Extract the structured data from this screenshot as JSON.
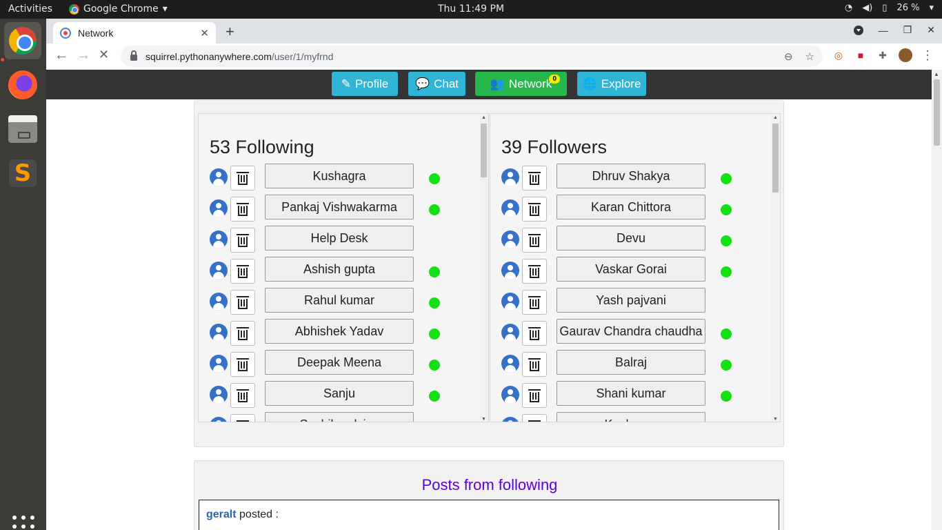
{
  "system": {
    "activities": "Activities",
    "app_name": "Google Chrome",
    "clock": "Thu 11:49 PM",
    "battery": "26 %"
  },
  "browser": {
    "tab_title": "Network",
    "url_host": "squirrel.pythonanywhere.com",
    "url_path": "/user/1/myfrnd"
  },
  "navbar": {
    "profile": "Profile",
    "chat": "Chat",
    "network": "Network",
    "network_badge": "0",
    "explore": "Explore"
  },
  "following": {
    "title": "53 Following",
    "items": [
      {
        "name": "Kushagra",
        "online": true
      },
      {
        "name": "Pankaj Vishwakarma",
        "online": true
      },
      {
        "name": "Help Desk",
        "online": false
      },
      {
        "name": "Ashish gupta",
        "online": true
      },
      {
        "name": "Rahul kumar",
        "online": true
      },
      {
        "name": "Abhishek Yadav",
        "online": true
      },
      {
        "name": "Deepak Meena",
        "online": true
      },
      {
        "name": "Sanju",
        "online": true
      },
      {
        "name": "Sushil malviya",
        "online": false
      }
    ]
  },
  "followers": {
    "title": "39 Followers",
    "items": [
      {
        "name": "Dhruv Shakya",
        "online": true
      },
      {
        "name": "Karan Chittora",
        "online": true
      },
      {
        "name": "Devu",
        "online": true
      },
      {
        "name": "Vaskar Gorai",
        "online": true
      },
      {
        "name": "Yash pajvani",
        "online": false
      },
      {
        "name": "Gaurav Chandra chaudha",
        "online": true
      },
      {
        "name": "Balraj",
        "online": true
      },
      {
        "name": "Shani kumar",
        "online": true
      },
      {
        "name": "Kushagra",
        "online": true
      }
    ]
  },
  "posts": {
    "title": "Posts from following",
    "first_author": "geralt",
    "first_action": " posted :"
  },
  "colors": {
    "online": "#12e012",
    "info_button": "#2fb6d6",
    "success_button": "#26b84a",
    "posts_title": "#5a00e0"
  }
}
